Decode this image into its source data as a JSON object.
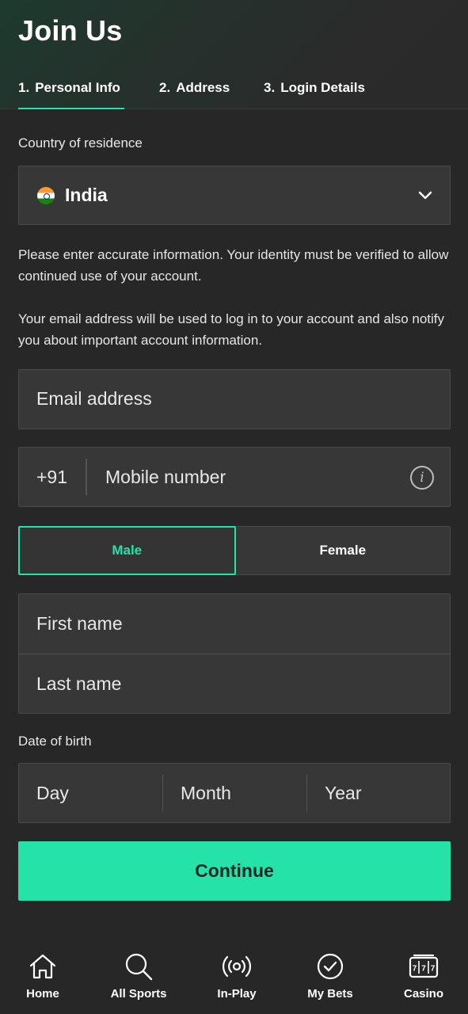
{
  "header": {
    "title": "Join Us",
    "tabs": [
      {
        "num": "1.",
        "label": "Personal Info",
        "active": true
      },
      {
        "num": "2.",
        "label": "Address",
        "active": false
      },
      {
        "num": "3.",
        "label": "Login Details",
        "active": false
      }
    ]
  },
  "form": {
    "country_label": "Country of residence",
    "country_value": "India",
    "info_identity": "Please enter accurate information. Your identity must be verified to allow continued use of your account.",
    "info_email": "Your email address will be used to log in to your account and also notify you about important account information.",
    "email_placeholder": "Email address",
    "phone_prefix": "+91",
    "mobile_placeholder": "Mobile number",
    "gender_options": [
      "Male",
      "Female"
    ],
    "gender_selected": "Male",
    "first_name_placeholder": "First name",
    "last_name_placeholder": "Last name",
    "dob_label": "Date of birth",
    "dob_day": "Day",
    "dob_month": "Month",
    "dob_year": "Year",
    "continue_label": "Continue"
  },
  "bottom_nav": [
    {
      "label": "Home",
      "icon": "home-icon"
    },
    {
      "label": "All Sports",
      "icon": "search-icon"
    },
    {
      "label": "In-Play",
      "icon": "broadcast-icon"
    },
    {
      "label": "My Bets",
      "icon": "checkmark-circle-icon"
    },
    {
      "label": "Casino",
      "icon": "slot-machine-icon"
    }
  ],
  "colors": {
    "accent": "#25e2a8",
    "background": "#272727",
    "field": "#373737"
  }
}
